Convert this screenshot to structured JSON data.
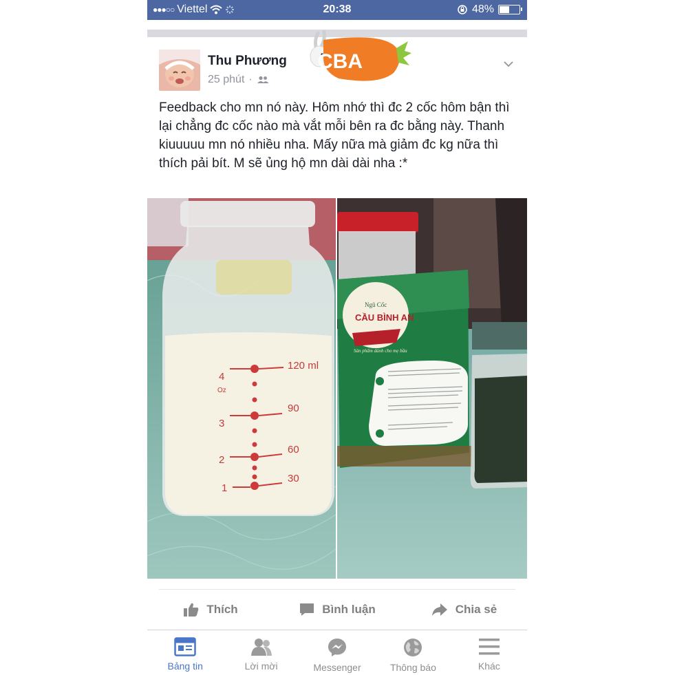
{
  "status_bar": {
    "carrier": "Viettel",
    "time": "20:38",
    "battery": "48%",
    "battery_level": 0.48
  },
  "post": {
    "author": "Thu Phương",
    "time_ago": "25 phút",
    "privacy_icon": "friends-icon",
    "text": "Feedback cho mn nó này. Hôm nhớ thì đc 2 cốc hôm bận thì lại chẳng đc cốc nào mà vắt mỗi bên ra đc bằng này. Thanh kiuuuuu mn nó nhiều nha. Mấy nữa mà giảm đc kg nữa thì thích pải bít. M sẽ ủng hộ mn dài dài nha :*",
    "watermark": "CBA",
    "photo_left": {
      "bottle_ml": [
        "120 ml",
        "90",
        "60",
        "30"
      ],
      "bottle_oz": [
        "4",
        "3",
        "2",
        "1"
      ],
      "bottle_oz_unit": "Oz"
    },
    "photo_right": {
      "box_small_title": "Ngũ Cốc",
      "box_brand": "CẦU BÌNH AN",
      "box_tagline": "Sản phẩm dành cho mẹ bầu"
    }
  },
  "actions": [
    {
      "label": "Thích",
      "icon": "like-icon"
    },
    {
      "label": "Bình luận",
      "icon": "comment-icon"
    },
    {
      "label": "Chia sẻ",
      "icon": "share-icon"
    }
  ],
  "tabs": [
    {
      "label": "Bảng tin",
      "icon": "news-feed-icon",
      "active": true
    },
    {
      "label": "Lời mời",
      "icon": "friend-requests-icon",
      "active": false
    },
    {
      "label": "Messenger",
      "icon": "messenger-icon",
      "active": false
    },
    {
      "label": "Thông báo",
      "icon": "globe-icon",
      "active": false
    },
    {
      "label": "Khác",
      "icon": "menu-icon",
      "active": false
    }
  ],
  "colors": {
    "status_bar": "#4c67a1",
    "active_tab": "#4a76c8",
    "inactive": "#8d8d8d",
    "watermark": "#f07d26"
  }
}
